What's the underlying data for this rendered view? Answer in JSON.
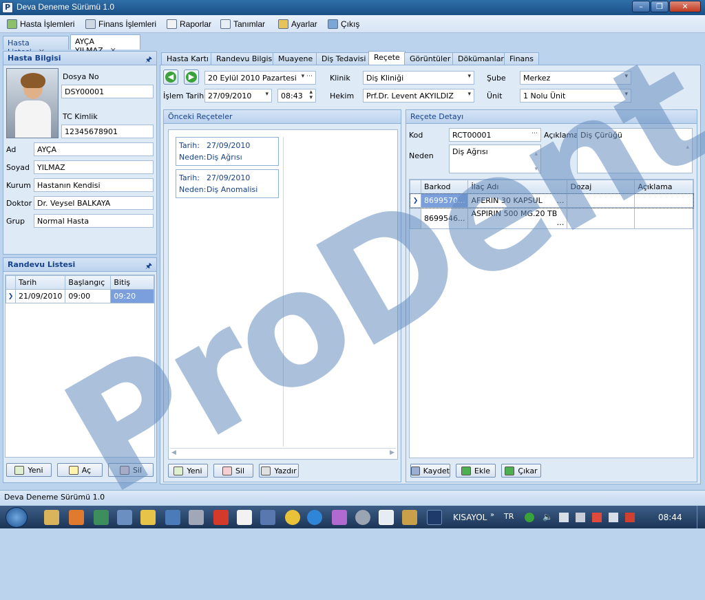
{
  "window": {
    "title": "Deva Deneme Sürümü 1.0",
    "icon_letter": "P"
  },
  "menu": [
    {
      "label": "Hasta İşlemleri",
      "icon": "patient-icon"
    },
    {
      "label": "Finans İşlemleri",
      "icon": "calculator-icon"
    },
    {
      "label": "Raporlar",
      "icon": "report-icon"
    },
    {
      "label": "Tanımlar",
      "icon": "list-icon"
    },
    {
      "label": "Ayarlar",
      "icon": "settings-icon"
    },
    {
      "label": "Çıkış",
      "icon": "exit-icon"
    }
  ],
  "doc_tabs": [
    {
      "label": "Hasta Listesi"
    },
    {
      "label": "AYÇA YILMAZ"
    }
  ],
  "patient": {
    "header": "Hasta Bilgisi",
    "dosya_no_label": "Dosya No",
    "dosya_no": "DSY00001",
    "tc_label": "TC Kimlik",
    "tc": "12345678901",
    "fields": [
      {
        "label": "Ad",
        "value": "AYÇA"
      },
      {
        "label": "Soyad",
        "value": "YILMAZ"
      },
      {
        "label": "Kurum",
        "value": "Hastanın Kendisi"
      },
      {
        "label": "Doktor",
        "value": "Dr. Veysel BALKAYA"
      },
      {
        "label": "Grup",
        "value": "Normal Hasta"
      }
    ]
  },
  "appointments": {
    "header": "Randevu Listesi",
    "columns": [
      "Tarih",
      "Başlangıç",
      "Bitiş"
    ],
    "rows": [
      [
        "21/09/2010",
        "09:00",
        "09:20"
      ]
    ],
    "buttons": [
      "Yeni",
      "Aç",
      "Sil"
    ]
  },
  "page_tabs": [
    "Hasta Kartı",
    "Randevu Bilgisi",
    "Muayene",
    "Diş Tedavisi",
    "Reçete",
    "Görüntüler",
    "Dökümanlar",
    "Finans"
  ],
  "form": {
    "date_value": "20 Eylül  2010 Pazartesi",
    "islem_tarihi_label": "İşlem Tarihi",
    "islem_tarihi": "27/09/2010",
    "time": "08:43",
    "klinik_label": "Klinik",
    "klinik": "Diş Kliniği",
    "hekim_label": "Hekim",
    "hekim": "Prf.Dr. Levent AKYILDIZ",
    "sube_label": "Şube",
    "sube": "Merkez",
    "unit_label": "Ünit",
    "unit": "1 Nolu Ünit"
  },
  "prev_recipes": {
    "header": "Önceki Reçeteler",
    "tarih_label": "Tarih:",
    "neden_label": "Neden:",
    "items": [
      {
        "tarih": "27/09/2010",
        "neden": "Diş Ağrısı"
      },
      {
        "tarih": "27/09/2010",
        "neden": "Diş Anomalisi"
      }
    ],
    "buttons": [
      "Yeni",
      "Sil",
      "Yazdır"
    ]
  },
  "recipe_detail": {
    "header": "Reçete Detayı",
    "kod_label": "Kod",
    "kod": "RCT00001",
    "aciklama_label": "Açıklama",
    "aciklama": "Diş Çürüğü",
    "neden_label": "Neden",
    "neden": "Diş Ağrısı",
    "columns": [
      "Barkod",
      "İlaç Adı",
      "Dozaj",
      "Açıklama"
    ],
    "rows": [
      [
        "8699570...",
        "AFERIN 30 KAPSUL",
        "",
        ""
      ],
      [
        "8699546...",
        "ASPIRIN 500 MG.20 TB",
        "",
        ""
      ]
    ],
    "buttons": [
      "Kaydet",
      "Ekle",
      "Çıkar"
    ]
  },
  "status": {
    "text": "Deva Deneme Sürümü 1.0"
  },
  "taskbar": {
    "kisayol": "KISAYOL",
    "lang": "TR",
    "clock": "08:44"
  },
  "watermark": "ProDent",
  "colors": {
    "accent": "#15428b",
    "selection": "#7a9fdc"
  }
}
